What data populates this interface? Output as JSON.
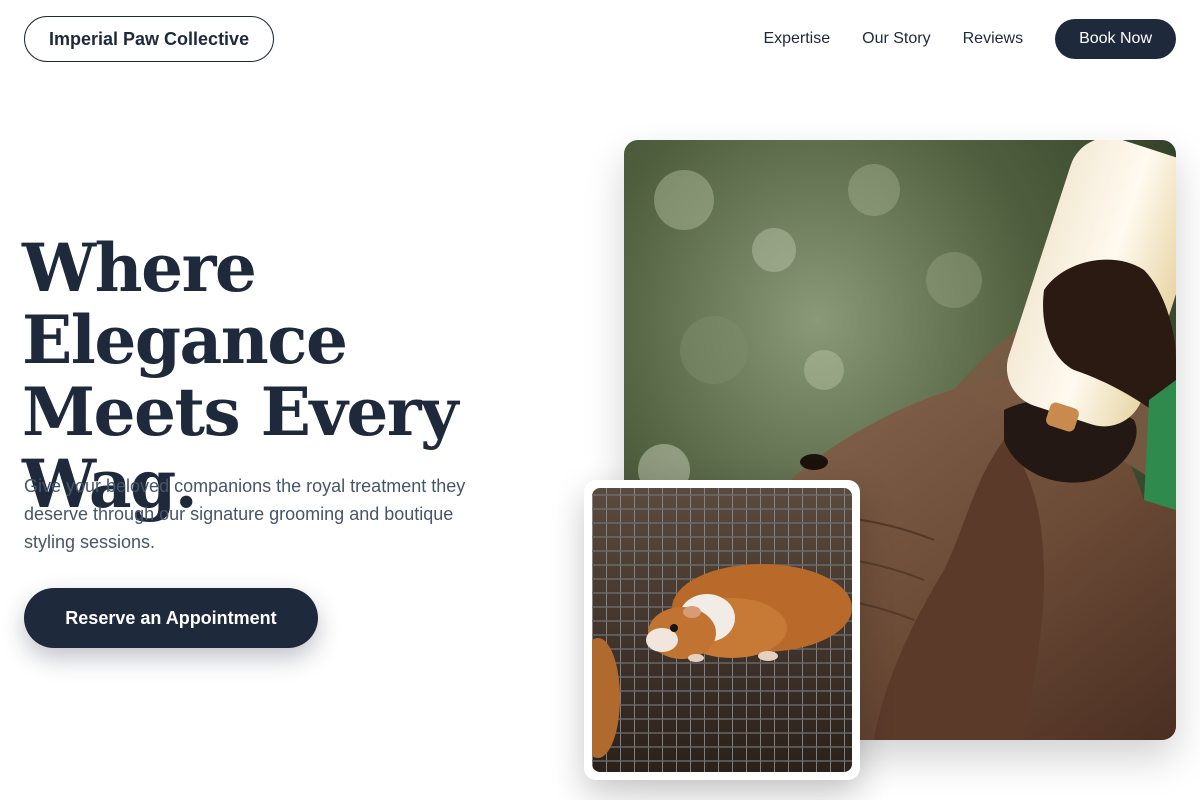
{
  "header": {
    "brand": "Imperial Paw Collective",
    "nav": [
      "Expertise",
      "Our Story",
      "Reviews"
    ],
    "book_label": "Book Now"
  },
  "hero": {
    "title_lines": [
      "Where Elegance",
      "Meets Every",
      "Wag."
    ],
    "subtitle": "Give your beloved companions the royal treatment they deserve through our signature grooming and boutique styling sessions.",
    "cta_label": "Reserve an Appointment"
  },
  "images": {
    "main": "elephant-calf-bottle-feeding-photo",
    "inset": "guinea-pig-on-wire-cage-photo"
  },
  "colors": {
    "primary": "#1e293b",
    "text_muted": "#475569",
    "background": "#ffffff"
  }
}
